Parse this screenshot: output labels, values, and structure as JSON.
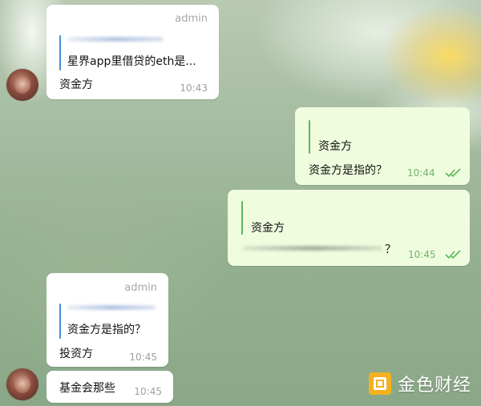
{
  "messages": [
    {
      "sender": "",
      "role": "admin",
      "quote_text": "星界app里借贷的eth是...",
      "text": "资金方",
      "time": "10:43"
    },
    {
      "quote_name": "",
      "quote_text": "资金方",
      "text": "资金方是指的？",
      "time": "10:44"
    },
    {
      "quote_name": "",
      "quote_text": "资金方",
      "text": "？",
      "time": "10:45"
    },
    {
      "sender": "",
      "role": "admin",
      "quote_text": "资金方是指的？",
      "text": "投资方",
      "time": "10:45"
    },
    {
      "text": "基金会那些",
      "time": "10:45"
    }
  ],
  "watermark": {
    "text": "金色财经"
  },
  "colors": {
    "incoming_bubble": "#ffffff",
    "outgoing_bubble": "#effdde",
    "sender_name": "#5aa853",
    "read_check": "#5cb65a",
    "quote_bar_incoming": "#4a8fd6"
  },
  "icons": [
    "double-check-icon",
    "avatar",
    "jinse-logo-icon"
  ]
}
